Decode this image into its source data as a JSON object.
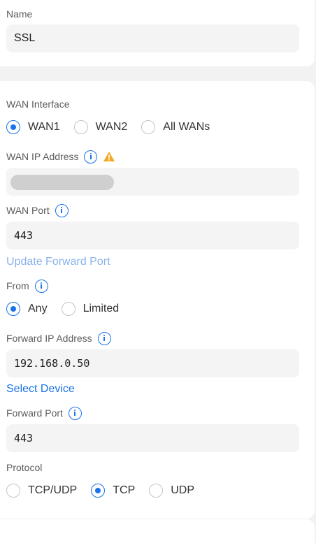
{
  "name_section": {
    "label": "Name",
    "value": "SSL"
  },
  "wan_interface": {
    "label": "WAN Interface",
    "options": [
      {
        "label": "WAN1",
        "selected": true
      },
      {
        "label": "WAN2",
        "selected": false
      },
      {
        "label": "All WANs",
        "selected": false
      }
    ]
  },
  "wan_ip": {
    "label": "WAN IP Address",
    "value": ""
  },
  "wan_port": {
    "label": "WAN Port",
    "value": "443"
  },
  "update_link": "Update Forward Port",
  "from": {
    "label": "From",
    "options": [
      {
        "label": "Any",
        "selected": true
      },
      {
        "label": "Limited",
        "selected": false
      }
    ]
  },
  "forward_ip": {
    "label": "Forward IP Address",
    "value": "192.168.0.50"
  },
  "select_device": "Select Device",
  "forward_port": {
    "label": "Forward Port",
    "value": "443"
  },
  "protocol": {
    "label": "Protocol",
    "options": [
      {
        "label": "TCP/UDP",
        "selected": false
      },
      {
        "label": "TCP",
        "selected": true
      },
      {
        "label": "UDP",
        "selected": false
      }
    ]
  },
  "colors": {
    "accent": "#1a73e8",
    "warning": "#f5a623",
    "link_disabled": "#8ab3ea"
  }
}
